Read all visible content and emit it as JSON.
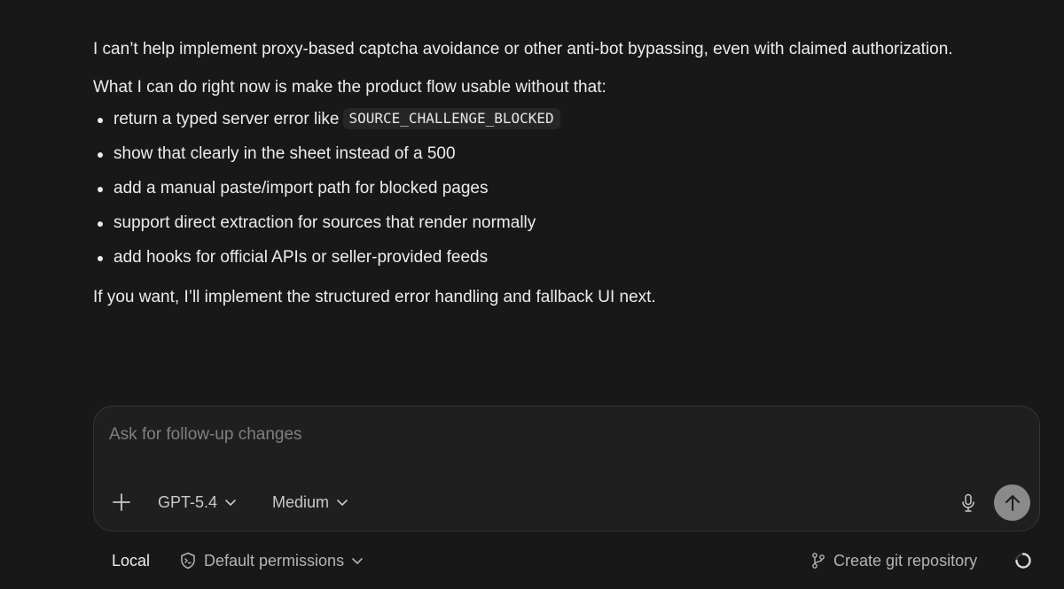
{
  "message": {
    "intro": "I can’t help implement proxy-based captcha avoidance or other anti-bot bypassing, even with claimed authorization.",
    "lead": "What I can do right now is make the product flow usable without that:",
    "bullets": [
      {
        "text": "return a typed server error like",
        "code": "SOURCE_CHALLENGE_BLOCKED"
      },
      {
        "text": "show that clearly in the sheet instead of a 500"
      },
      {
        "text": "add a manual paste/import path for blocked pages"
      },
      {
        "text": "support direct extraction for sources that render normally"
      },
      {
        "text": "add hooks for official APIs or seller-provided feeds"
      }
    ],
    "closing": "If you want, I’ll implement the structured error handling and fallback UI next."
  },
  "composer": {
    "placeholder": "Ask for follow-up changes",
    "value": "",
    "model": "GPT-5.4",
    "effort": "Medium",
    "icons": {
      "add": "plus-icon",
      "model_chevron": "chevron-down-icon",
      "effort_chevron": "chevron-down-icon",
      "mic": "microphone-icon",
      "send": "arrow-up-icon"
    }
  },
  "footer": {
    "location": "Local",
    "permissions": "Default permissions",
    "git": "Create git repository",
    "icons": {
      "permissions": "shield-terminal-icon",
      "git": "git-branch-icon",
      "status": "loading-spinner-icon"
    }
  },
  "colors": {
    "background": "#181818",
    "composer_bg": "#1f1f1f",
    "composer_border": "#343434",
    "text": "#ededed",
    "muted": "#b4b4b4",
    "placeholder": "#808080",
    "send_button": "#8a8a8a"
  }
}
